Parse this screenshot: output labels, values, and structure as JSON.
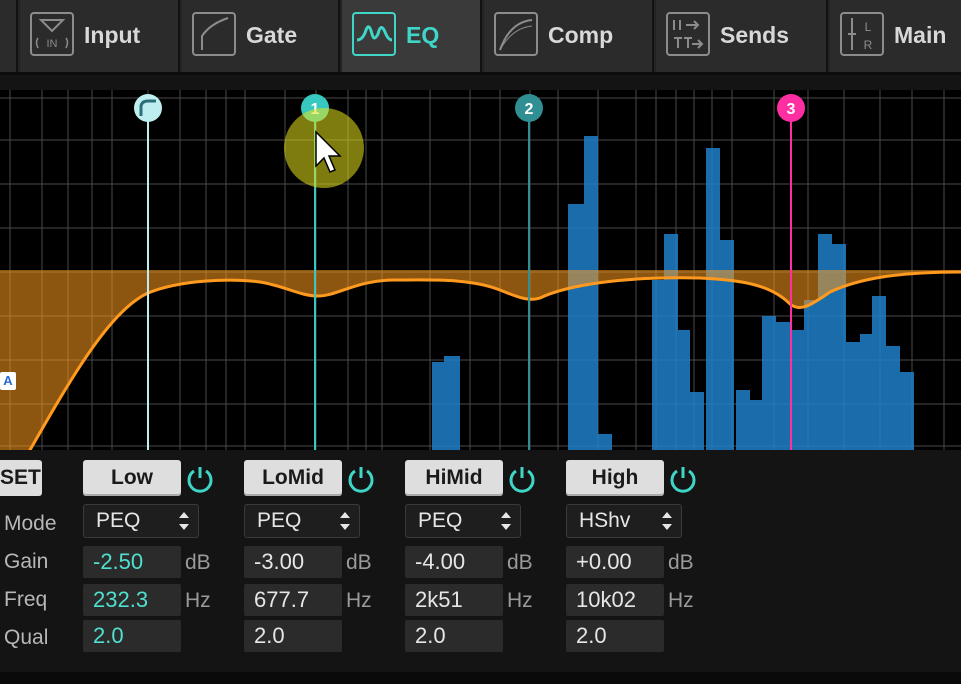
{
  "tabs": [
    {
      "label": "Input",
      "icon": "input-in-icon"
    },
    {
      "label": "Gate",
      "icon": "gate-curve-icon"
    },
    {
      "label": "EQ",
      "icon": "eq-curve-icon",
      "active": true
    },
    {
      "label": "Comp",
      "icon": "comp-curve-icon"
    },
    {
      "label": "Sends",
      "icon": "sends-icon"
    },
    {
      "label": "Main",
      "icon": "main-lr-icon"
    }
  ],
  "graph": {
    "nodes": [
      {
        "label": "",
        "color": "#bfeef0",
        "type": "highpass"
      },
      {
        "label": "1",
        "color": "#37c9c0"
      },
      {
        "label": "2",
        "color": "#2f8f93"
      },
      {
        "label": "3",
        "color": "#ff2ea1"
      }
    ],
    "edge_badge": "A",
    "curve_color": "#ff9a1e",
    "spectrum_color": "#1f7fc8"
  },
  "panel": {
    "reset_label": "SET",
    "row_labels": {
      "mode": "Mode",
      "gain": "Gain",
      "freq": "Freq",
      "qual": "Qual"
    },
    "units": {
      "gain": "dB",
      "freq": "Hz"
    },
    "bands": [
      {
        "name": "Low",
        "mode": "PEQ",
        "gain": "-2.50",
        "freq": "232.3",
        "q": "2.0",
        "selected": true
      },
      {
        "name": "LoMid",
        "mode": "PEQ",
        "gain": "-3.00",
        "freq": "677.7",
        "q": "2.0"
      },
      {
        "name": "HiMid",
        "mode": "PEQ",
        "gain": "-4.00",
        "freq": "2k51",
        "q": "2.0"
      },
      {
        "name": "High",
        "mode": "HShv",
        "gain": "+0.00",
        "freq": "10k02",
        "q": "2.0"
      }
    ],
    "accent_color": "#4fe0cf"
  }
}
